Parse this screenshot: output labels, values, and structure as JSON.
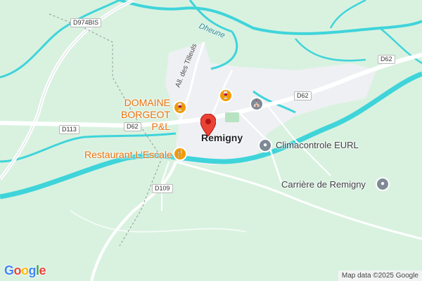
{
  "map": {
    "place_label": "Remigny",
    "street_label": "All. des Tilleuls",
    "river_label": "Dheune",
    "road_shields": [
      "D974BIS",
      "D62",
      "D113",
      "D62",
      "D62",
      "D109"
    ],
    "pois": [
      {
        "name": "DOMAINE\nBORGEOT P&L",
        "icon": "wine-icon",
        "category": "winery"
      },
      {
        "name": "Restaurant L'Escale",
        "icon": "restaurant-icon",
        "category": "restaurant"
      },
      {
        "name": "Climacontrole EURL",
        "icon": "business-icon",
        "category": "business"
      },
      {
        "name": "Carrière de Remigny",
        "icon": "place-icon",
        "category": "place"
      },
      {
        "name": "",
        "icon": "wine-icon",
        "category": "winery"
      },
      {
        "name": "",
        "icon": "landmark-icon",
        "category": "landmark"
      }
    ],
    "marker_icon": "red-pin-icon",
    "colors": {
      "land": "#d9f2e0",
      "water": "#3fd4da",
      "urban": "#eceff3",
      "poi_orange": "#e8710a",
      "marker": "#ea4335"
    }
  },
  "branding": {
    "logo_letters": [
      "G",
      "o",
      "o",
      "g",
      "l",
      "e"
    ],
    "logo_colors": [
      "#4285F4",
      "#EA4335",
      "#FBBC05",
      "#4285F4",
      "#34A853",
      "#EA4335"
    ],
    "attribution": "Map data ©2025 Google"
  }
}
